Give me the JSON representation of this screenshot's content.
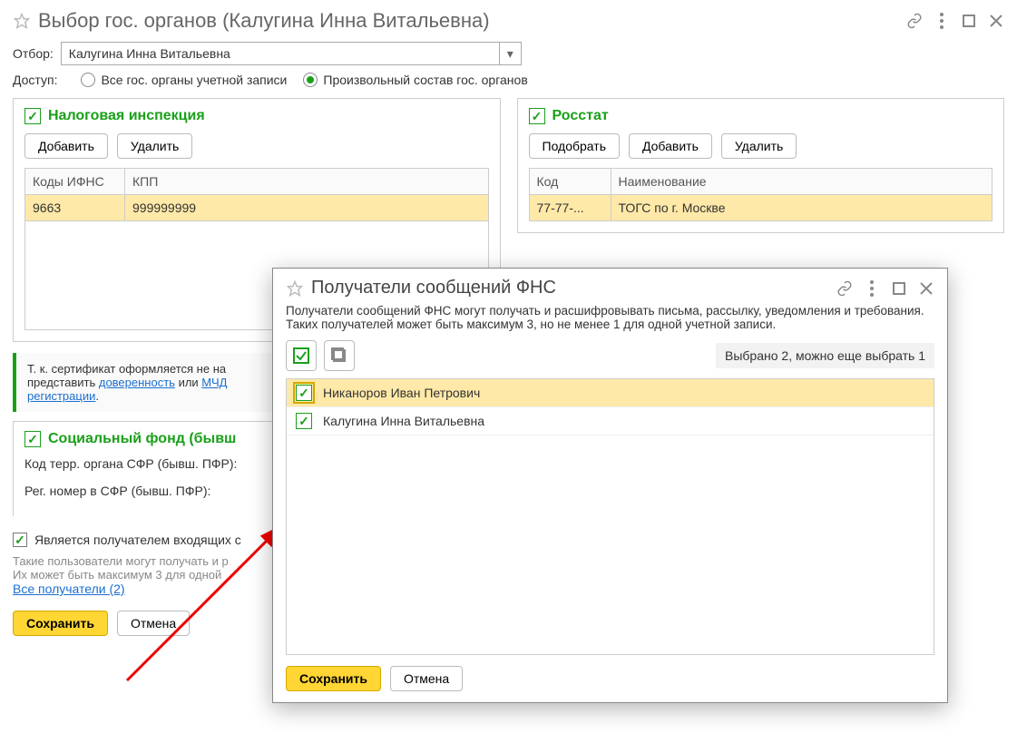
{
  "main": {
    "title": "Выбор гос. органов (Калугина Инна Витальевна)",
    "filter_label": "Отбор:",
    "filter_value": "Калугина Инна Витальевна",
    "access_label": "Доступ:",
    "access_opt_all": "Все гос. органы учетной записи",
    "access_opt_custom": "Произвольный состав гос. органов"
  },
  "tax": {
    "title": "Налоговая инспекция",
    "add": "Добавить",
    "del": "Удалить",
    "col1": "Коды ИФНС",
    "col2": "КПП",
    "row_code": "9663",
    "row_kpp": "999999999"
  },
  "rosstat": {
    "title": "Росстат",
    "pick": "Подобрать",
    "add": "Добавить",
    "del": "Удалить",
    "col1": "Код",
    "col2": "Наименование",
    "row_code": "77-77-...",
    "row_name": "ТОГС по г. Москве"
  },
  "notice": {
    "text_a": "Т. к. сертификат оформляется не на",
    "text_b": "представить ",
    "link1": "доверенность",
    "text_c": " или ",
    "link2": "МЧД",
    "link3": "регистрации",
    "dot": "."
  },
  "social": {
    "title": "Социальный фонд (бывш",
    "lbl_code": "Код терр. органа СФР (бывш. ПФР):",
    "lbl_reg": "Рег. номер в СФР (бывш. ПФР):"
  },
  "receiver": {
    "checkbox_label": "Является получателем входящих с",
    "grey1": "Такие пользователи могут получать и р",
    "grey2": "Их может быть максимум 3 для одной",
    "all_link": "Все получатели (2)"
  },
  "footer": {
    "save": "Сохранить",
    "cancel": "Отмена"
  },
  "dialog": {
    "title": "Получатели сообщений ФНС",
    "desc": "Получатели сообщений ФНС могут получать и расшифровывать письма, рассылку, уведомления и требования. Таких получателей может быть максимум 3, но не менее 1 для одной учетной записи.",
    "status": "Выбрано 2, можно еще выбрать 1",
    "rows": [
      {
        "name": "Никаноров Иван Петрович",
        "checked": true,
        "selected": true
      },
      {
        "name": "Калугина Инна Витальевна",
        "checked": true,
        "selected": false
      }
    ],
    "save": "Сохранить",
    "cancel": "Отмена"
  }
}
